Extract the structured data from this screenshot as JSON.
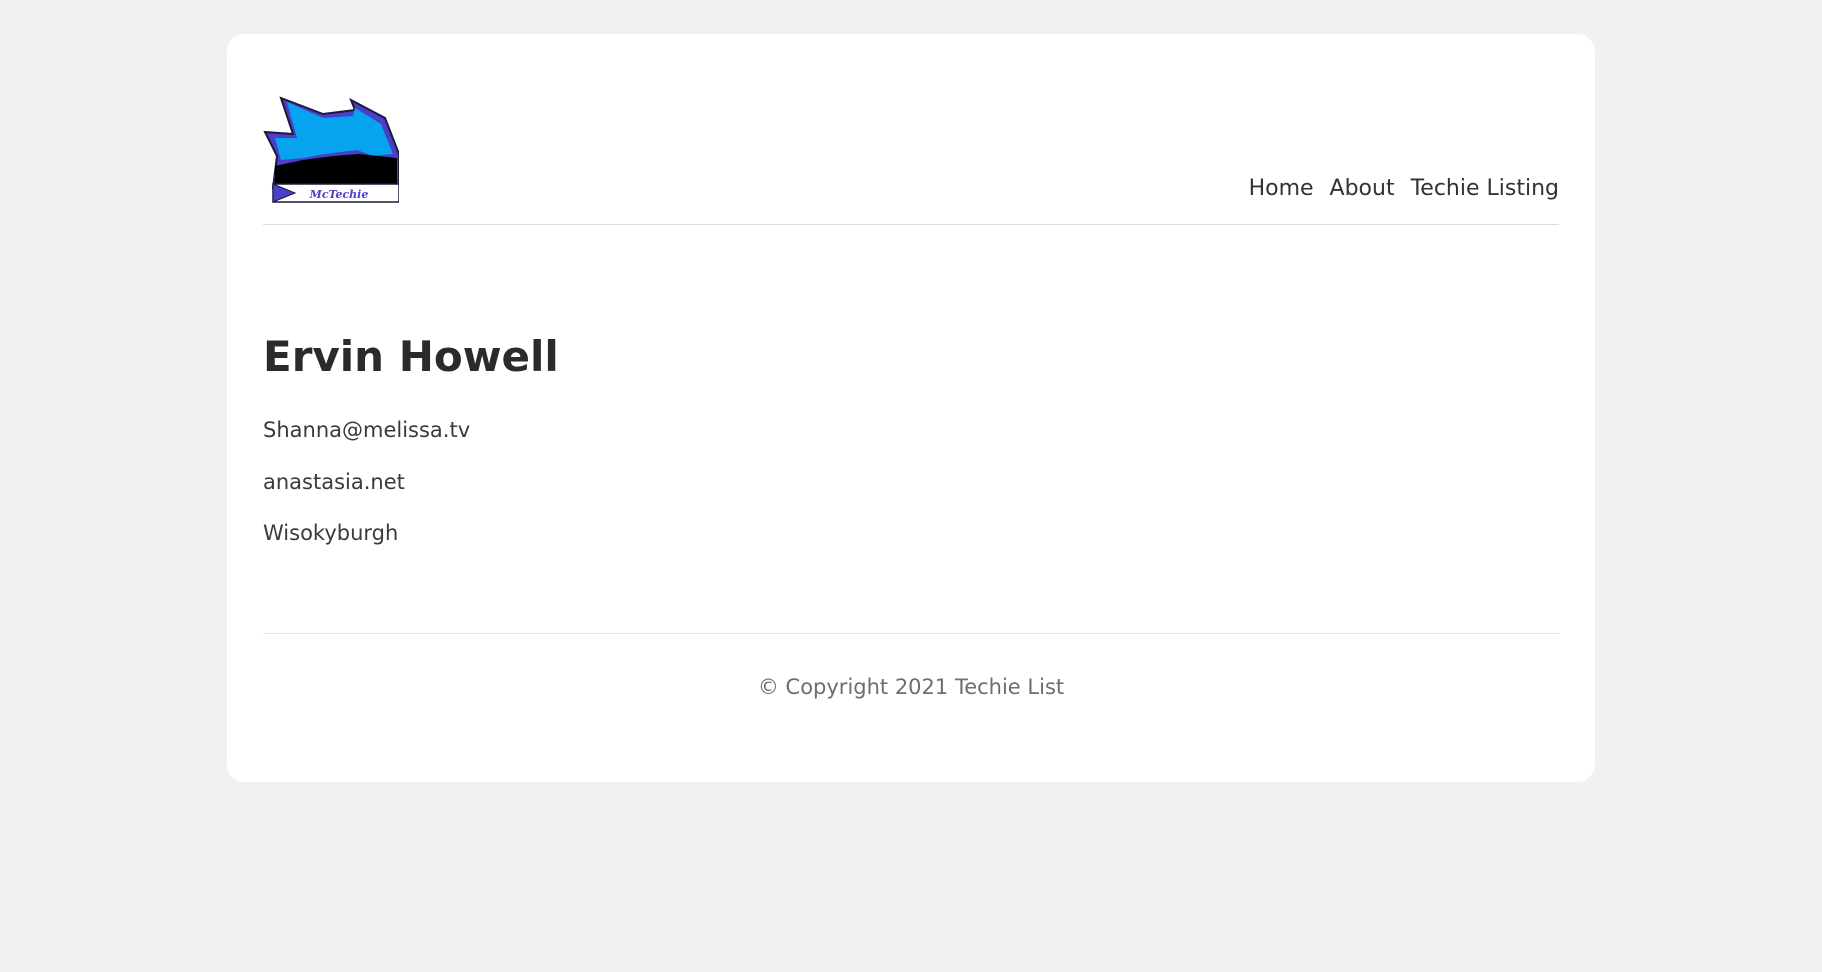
{
  "brand": {
    "logo_text": "McTechie"
  },
  "nav": {
    "items": [
      {
        "label": "Home"
      },
      {
        "label": "About"
      },
      {
        "label": "Techie Listing"
      }
    ]
  },
  "profile": {
    "name": "Ervin Howell",
    "email": "Shanna@melissa.tv",
    "website": "anastasia.net",
    "city": "Wisokyburgh"
  },
  "footer": {
    "copyright": "© Copyright 2021 Techie List"
  },
  "colors": {
    "background": "#f1f1f1",
    "card": "#ffffff",
    "logo_blue": "#06a3ef",
    "logo_purple": "#4b3fc9"
  }
}
